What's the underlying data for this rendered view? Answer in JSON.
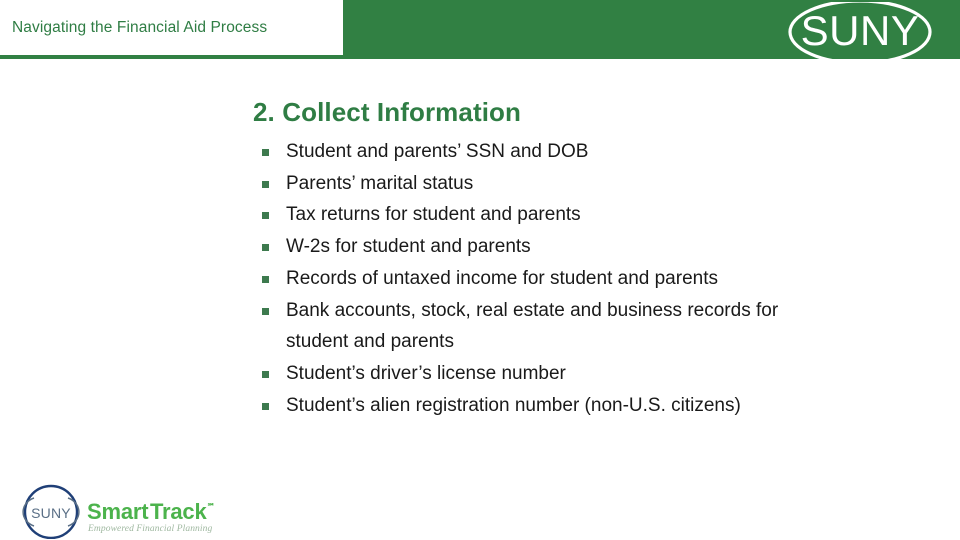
{
  "header": {
    "title": "Navigating the Financial Aid Process",
    "band_color": "#318043",
    "title_color": "#2f7d44",
    "logo": {
      "name": "suny-logo",
      "wordmark": "SUNY",
      "color": "#ffffff"
    }
  },
  "slide": {
    "title": "2. Collect Information",
    "title_color": "#2f7d44",
    "bullet_color": "#3d7a4e",
    "text_color": "#1a1a1a",
    "bullets": [
      {
        "text": "Student and parents’ SSN and DOB",
        "marker": true
      },
      {
        "text": "Parents’ marital status",
        "marker": true
      },
      {
        "text": "Tax returns for student and parents",
        "marker": true
      },
      {
        "text": "W-2s for student and parents",
        "marker": true
      },
      {
        "text": "Records of untaxed income for student and parents",
        "marker": true
      },
      {
        "text": "Bank accounts, stock, real estate and business records for",
        "marker": true
      },
      {
        "text": "student and parents",
        "marker": false
      },
      {
        "text": "Student’s driver’s license number",
        "marker": true
      },
      {
        "text": "Student’s alien registration number (non-U.S. citizens)",
        "marker": true
      }
    ]
  },
  "footer_logo": {
    "name": "suny-smart-track-logo",
    "suny_wordmark": "SUNY",
    "brand_word_1": "Smart",
    "brand_word_2": "Track",
    "trademark": "℠",
    "tagline": "Empowered Financial Planning",
    "ring_color": "#1f3f77",
    "suny_text_color": "#5a6f86",
    "brand_color": "#4cb34c",
    "tagline_color": "#9fb8a0"
  }
}
